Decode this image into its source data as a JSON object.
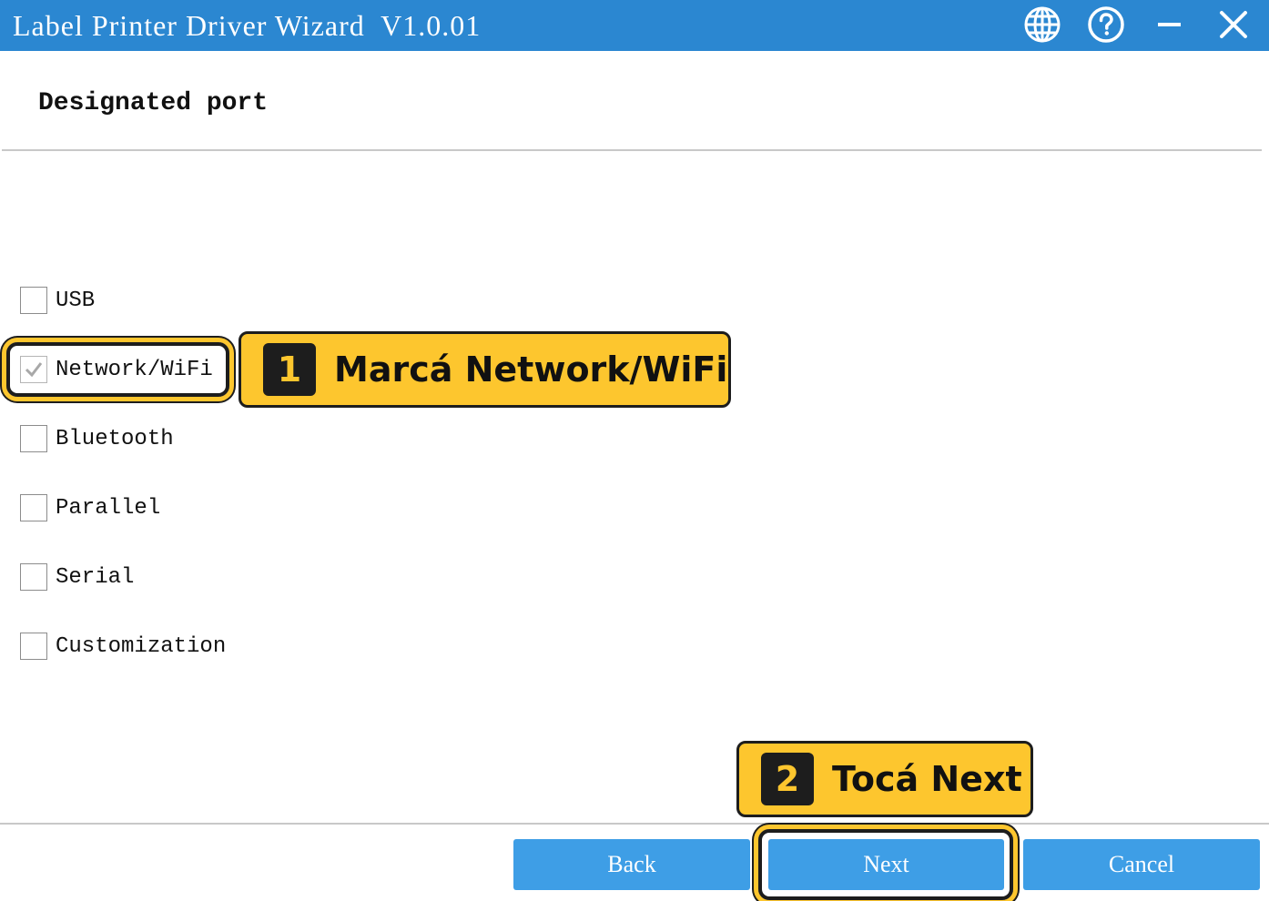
{
  "window": {
    "title": "Label Printer Driver Wizard  V1.0.01",
    "title_bar_color": "#2b87d1",
    "icons": [
      "globe-icon",
      "help-icon",
      "minimize-icon",
      "close-icon"
    ]
  },
  "header": {
    "title": "Designated port"
  },
  "ports": [
    {
      "label": "USB",
      "checked": false
    },
    {
      "label": "Network/WiFi",
      "checked": true
    },
    {
      "label": "Bluetooth",
      "checked": false
    },
    {
      "label": "Parallel",
      "checked": false
    },
    {
      "label": "Serial",
      "checked": false
    },
    {
      "label": "Customization",
      "checked": false
    }
  ],
  "callouts": [
    {
      "step": "1",
      "text": "Marcá Network/WiFi"
    },
    {
      "step": "2",
      "text": "Tocá Next"
    }
  ],
  "buttons": {
    "back": "Back",
    "next": "Next",
    "cancel": "Cancel"
  },
  "colors": {
    "accent": "#3e9ee6",
    "callout": "#fdc62e",
    "callout_border": "#1d1d1d"
  }
}
